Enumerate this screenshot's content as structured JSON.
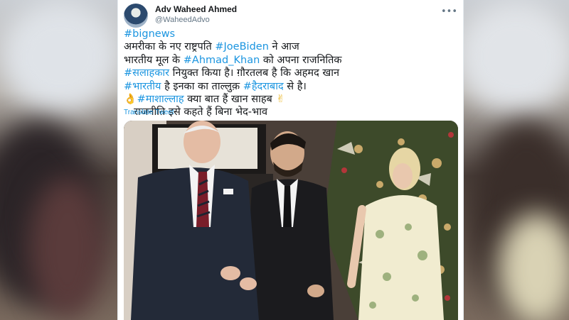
{
  "tweet": {
    "author": {
      "name": "Adv Waheed Ahmed",
      "handle": "@WaheedAdvo"
    },
    "lines": [
      [
        {
          "t": "#bignews",
          "tag": true
        }
      ],
      [
        {
          "t": "अमरीका के नए राष्ट्रपति ",
          "tag": false
        },
        {
          "t": "#JoeBiden",
          "tag": true
        },
        {
          "t": " ने आज",
          "tag": false
        }
      ],
      [
        {
          "t": "भारतीय मूल के ",
          "tag": false
        },
        {
          "t": "#Ahmad_Khan",
          "tag": true
        },
        {
          "t": " को अपना राजनितिक",
          "tag": false
        }
      ],
      [
        {
          "t": "#सलाहकार",
          "tag": true
        },
        {
          "t": " नियुक्त किया है। ग़ौरतलब है कि अहमद खान",
          "tag": false
        }
      ],
      [
        {
          "t": "#भारतीय",
          "tag": true
        },
        {
          "t": " है इनका का ताल्लुक़ ",
          "tag": false
        },
        {
          "t": "#हैदराबाद",
          "tag": true
        },
        {
          "t": " से है।",
          "tag": false
        }
      ],
      [
        {
          "t": "#माशाल्लाह",
          "tag": true
        },
        {
          "t": " क्या बात हैं खान साहब ",
          "tag": false
        }
      ],
      [
        {
          "t": "राजनीति इसे कहते हैं बिना भेद-भाव",
          "tag": false
        }
      ]
    ],
    "translate_label": "Translate Tweet"
  },
  "icons": {
    "more": "more-options-icon",
    "ok_hand": "ok-hand-emoji-icon",
    "victory_hand": "victory-hand-emoji-icon"
  },
  "colors": {
    "link": "#1b95e0",
    "text": "#14171a",
    "muted": "#657786"
  }
}
